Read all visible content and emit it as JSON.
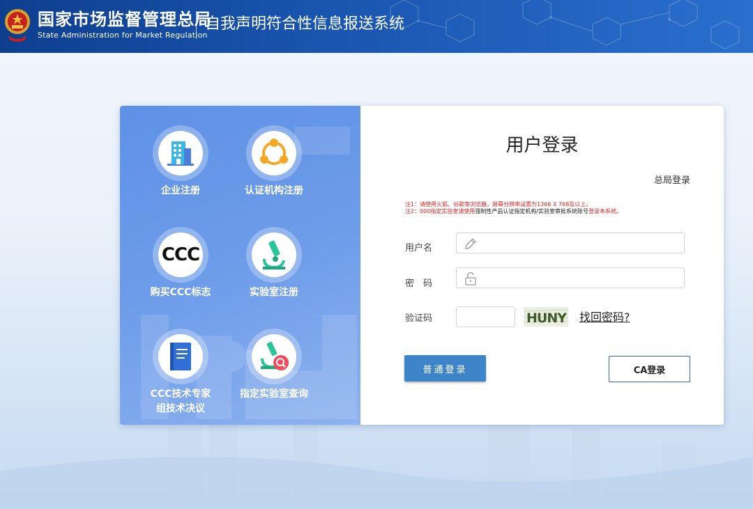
{
  "header": {
    "title_cn": "国家市场监督管理总局",
    "title_en": "State Administration  for  Market Regulation",
    "system_name": "自我声明符合性信息报送系统"
  },
  "tiles": [
    {
      "label": "企业注册",
      "icon": "building-icon"
    },
    {
      "label": "认证机构注册",
      "icon": "network-icon"
    },
    {
      "label": "购买CCC标志",
      "icon": "ccc-logo-icon"
    },
    {
      "label": "实验室注册",
      "icon": "microscope-icon"
    },
    {
      "label": "CCC技术专家组技术决议",
      "label_line1": "CCC技术专家",
      "label_line2": "组技术决议",
      "icon": "book-icon"
    },
    {
      "label": "指定实验室查询",
      "icon": "microscope-search-icon"
    }
  ],
  "ccc_mark": "CCC",
  "login": {
    "title": "用户登录",
    "hq_login": "总局登录",
    "note1": "注1：请使用火狐、谷歌等浏览器，屏幕分辨率设置为1366 X 768及以上。",
    "note2_red_a": "注2：000指定实验室请使用",
    "note2_black": "强制性产品认证指定机构/实验室审批系统账号",
    "note2_red_b": "登录本系统。",
    "username_label": "用户名",
    "password_label": "密　码",
    "captcha_label": "验证码",
    "captcha_text": "HUNY",
    "forgot_link": "找回密码?",
    "normal_login": "普通登录",
    "ca_login": "CA登录"
  },
  "colors": {
    "header_blue": "#1a56b0",
    "panel_blue": "#6d9ce9",
    "button_blue": "#3d84c8"
  }
}
